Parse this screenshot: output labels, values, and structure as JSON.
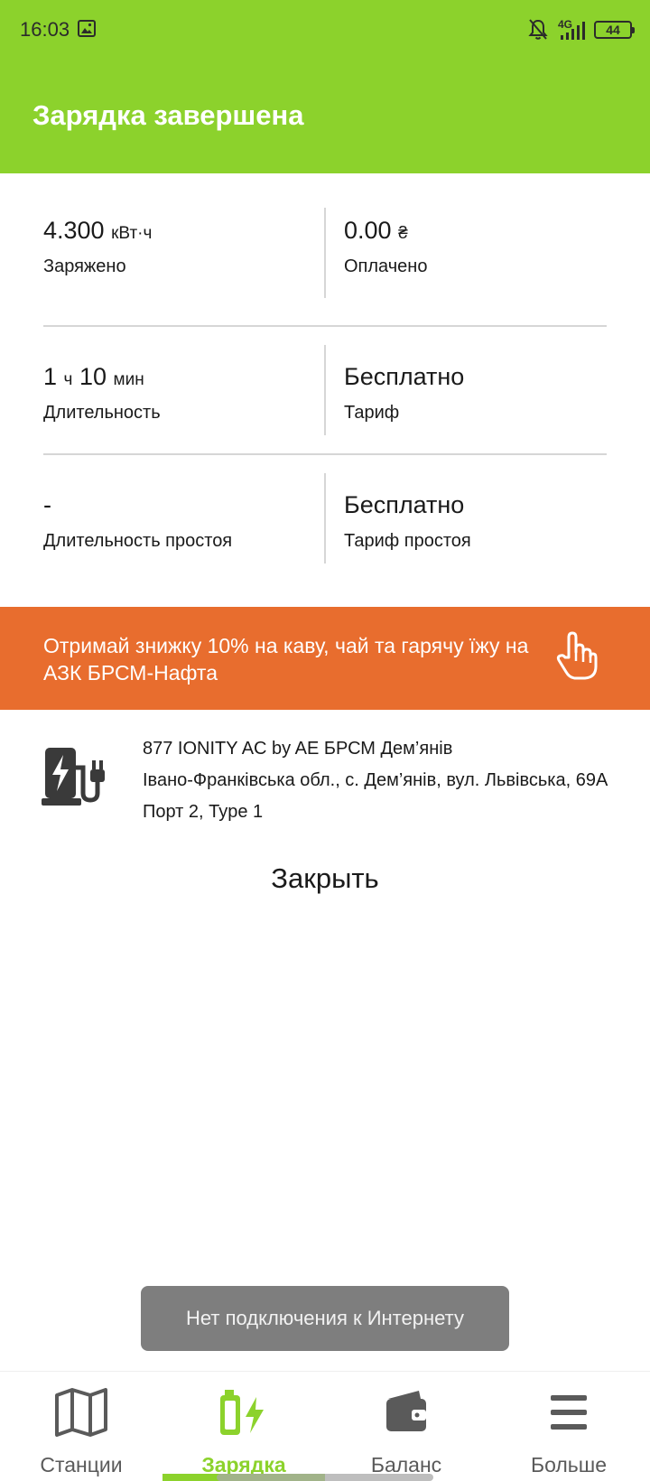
{
  "status_bar": {
    "time": "16:03",
    "network": "4G",
    "battery": "44"
  },
  "header": {
    "title": "Зарядка завершена"
  },
  "stats": {
    "charged_value": "4.300",
    "charged_unit": "кВт·ч",
    "charged_label": "Заряжено",
    "paid_value": "0.00",
    "paid_unit": "₴",
    "paid_label": "Оплачено",
    "duration_hours": "1",
    "duration_hours_unit": "ч",
    "duration_minutes": "10",
    "duration_minutes_unit": "мин",
    "duration_label": "Длительность",
    "tariff_value": "Бесплатно",
    "tariff_label": "Тариф",
    "idle_duration_value": "-",
    "idle_duration_label": "Длительность простоя",
    "idle_tariff_value": "Бесплатно",
    "idle_tariff_label": "Тариф простоя"
  },
  "promo": {
    "text": "Отримай знижку 10% на каву, чай та гарячу їжу на АЗК БРСМ-Нафта",
    "color": "#e86d2e"
  },
  "station": {
    "name": "877 IONITY AC by AE БРСМ Дем’янів",
    "address": "Івано-Франківська обл., с. Дем’янів, вул. Львівська, 69А",
    "port": "Порт 2, Type 1",
    "icon": "ev-charger-icon"
  },
  "close_label": "Закрыть",
  "toast": {
    "text": "Нет подключения к Интернету"
  },
  "bottom_nav": {
    "accent": "#8cd22c",
    "items": [
      {
        "label": "Станции",
        "icon": "map-icon",
        "active": false
      },
      {
        "label": "Зарядка",
        "icon": "charging-battery-icon",
        "active": true
      },
      {
        "label": "Баланс",
        "icon": "wallet-icon",
        "active": false
      },
      {
        "label": "Больше",
        "icon": "menu-icon",
        "active": false
      }
    ]
  }
}
